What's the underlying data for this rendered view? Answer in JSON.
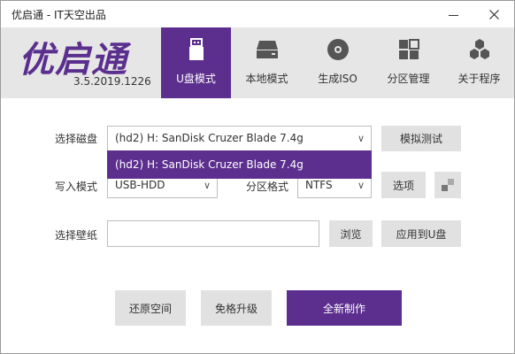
{
  "window": {
    "title": "优启通 - IT天空出品"
  },
  "logo": {
    "text": "优启通",
    "version": "3.5.2019.1226"
  },
  "nav": {
    "tabs": [
      {
        "label": "U盘模式",
        "icon": "usb-drive-icon",
        "active": true
      },
      {
        "label": "本地模式",
        "icon": "hard-drive-icon",
        "active": false
      },
      {
        "label": "生成ISO",
        "icon": "disc-icon",
        "active": false
      },
      {
        "label": "分区管理",
        "icon": "partition-grid-icon",
        "active": false
      },
      {
        "label": "关于程序",
        "icon": "hexagon-cluster-icon",
        "active": false
      }
    ]
  },
  "form": {
    "disk_label": "选择磁盘",
    "disk_value": "(hd2) H: SanDisk Cruzer Blade 7.4g",
    "disk_option": "(hd2) H: SanDisk Cruzer Blade 7.4g",
    "simulate_button": "模拟测试",
    "write_mode_label": "写入模式",
    "write_mode_value": "USB-HDD",
    "partition_format_label": "分区格式",
    "partition_format_value": "NTFS",
    "options_button": "选项",
    "wallpaper_label": "选择壁纸",
    "wallpaper_value": "",
    "browse_button": "浏览",
    "apply_button": "应用到U盘"
  },
  "actions": {
    "restore_label": "还原空间",
    "upgrade_label": "免格升级",
    "create_label": "全新制作"
  },
  "colors": {
    "accent": "#5c2f8e",
    "header_bg": "#e6e6e6",
    "button_bg": "#e1e1e1"
  }
}
